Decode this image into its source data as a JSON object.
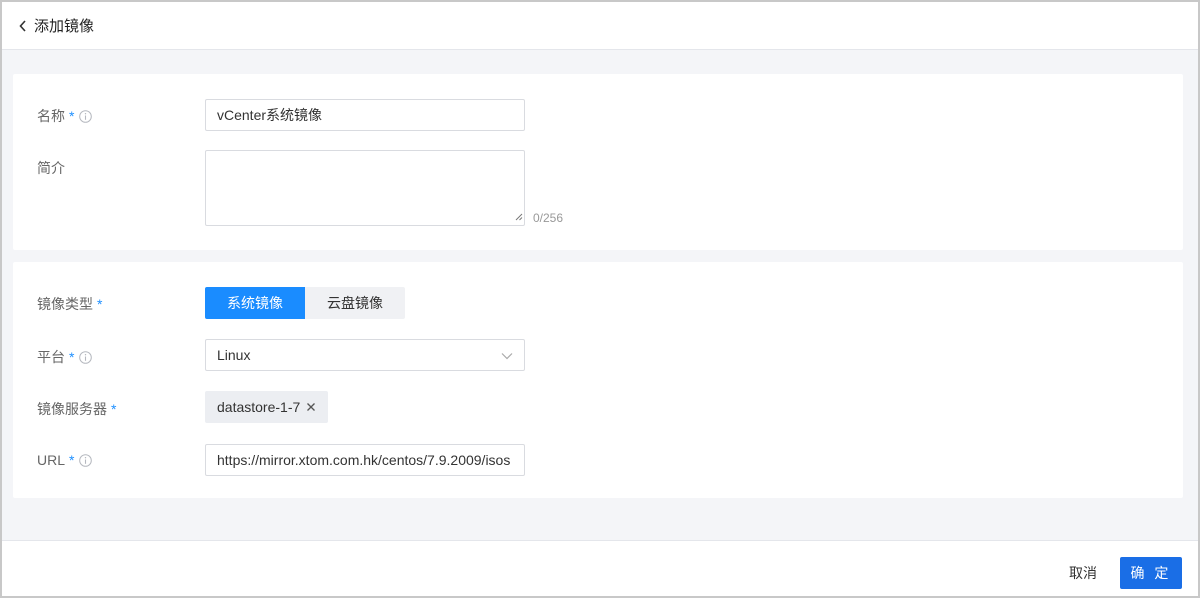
{
  "header": {
    "title": "添加镜像"
  },
  "basic": {
    "name_label": "名称",
    "name_value": "vCenter系统镜像",
    "desc_label": "简介",
    "desc_counter": "0/256"
  },
  "image": {
    "type_label": "镜像类型",
    "type_options": [
      "系统镜像",
      "云盘镜像"
    ],
    "type_selected": "系统镜像",
    "platform_label": "平台",
    "platform_value": "Linux",
    "server_label": "镜像服务器",
    "server_tag": "datastore-1-7",
    "url_label": "URL",
    "url_value": "https://mirror.xtom.com.hk/centos/7.9.2009/isos"
  },
  "required_mark": "*",
  "footer": {
    "cancel": "取消",
    "confirm": "确 定"
  },
  "colors": {
    "primary": "#1a8cff",
    "required": "#1e8fff"
  }
}
